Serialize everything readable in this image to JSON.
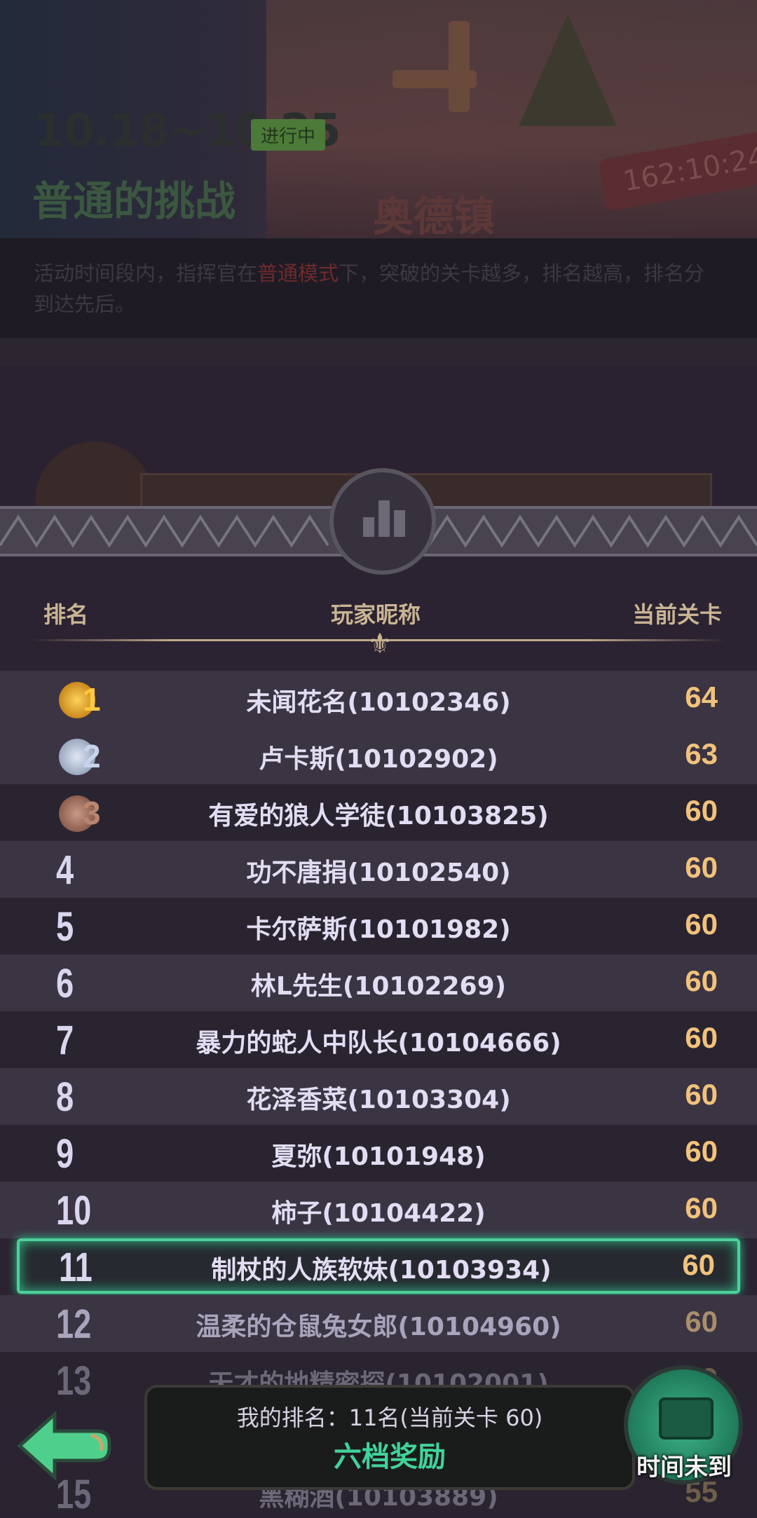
{
  "event": {
    "dates": "10.18~10.25",
    "status": "进行中",
    "title": "普通的挑战",
    "location": "奥德镇",
    "timer": "162:10:24",
    "description_pre": "活动时间段内，指挥官在",
    "description_mode": "普通模式",
    "description_post": "下，突破的关卡越多，排名越高，排名分到达先后。"
  },
  "table": {
    "headers": {
      "rank": "排名",
      "nickname": "玩家昵称",
      "stage": "当前关卡"
    },
    "rows": [
      {
        "rank": "1",
        "name": "未闻花名(10102346)",
        "stage": "64"
      },
      {
        "rank": "2",
        "name": "卢卡斯(10102902)",
        "stage": "63"
      },
      {
        "rank": "3",
        "name": "有爱的狼人学徒(10103825)",
        "stage": "60"
      },
      {
        "rank": "4",
        "name": "功不唐捐(10102540)",
        "stage": "60"
      },
      {
        "rank": "5",
        "name": "卡尔萨斯(10101982)",
        "stage": "60"
      },
      {
        "rank": "6",
        "name": "林L先生(10102269)",
        "stage": "60"
      },
      {
        "rank": "7",
        "name": "暴力的蛇人中队长(10104666)",
        "stage": "60"
      },
      {
        "rank": "8",
        "name": "花泽香菜(10103304)",
        "stage": "60"
      },
      {
        "rank": "9",
        "name": "夏弥(10101948)",
        "stage": "60"
      },
      {
        "rank": "10",
        "name": "柿子(10104422)",
        "stage": "60"
      },
      {
        "rank": "11",
        "name": "制杖的人族软妹(10103934)",
        "stage": "60"
      },
      {
        "rank": "12",
        "name": "温柔的仓鼠兔女郎(10104960)",
        "stage": "60"
      },
      {
        "rank": "13",
        "name": "天才的地精密探(10102001)",
        "stage": "59"
      },
      {
        "rank": "15",
        "name": "黑糊酒(10103889)",
        "stage": "55"
      }
    ]
  },
  "my_rank": {
    "text": "我的排名：11名(当前关卡 60)",
    "reward": "六档奖励"
  },
  "chest_label": "时间未到",
  "colors": {
    "highlight": "#4ecf9c",
    "stage_value": "#f2c27c",
    "reward_text": "#41d39a",
    "mode_text": "#6e2b2d"
  }
}
